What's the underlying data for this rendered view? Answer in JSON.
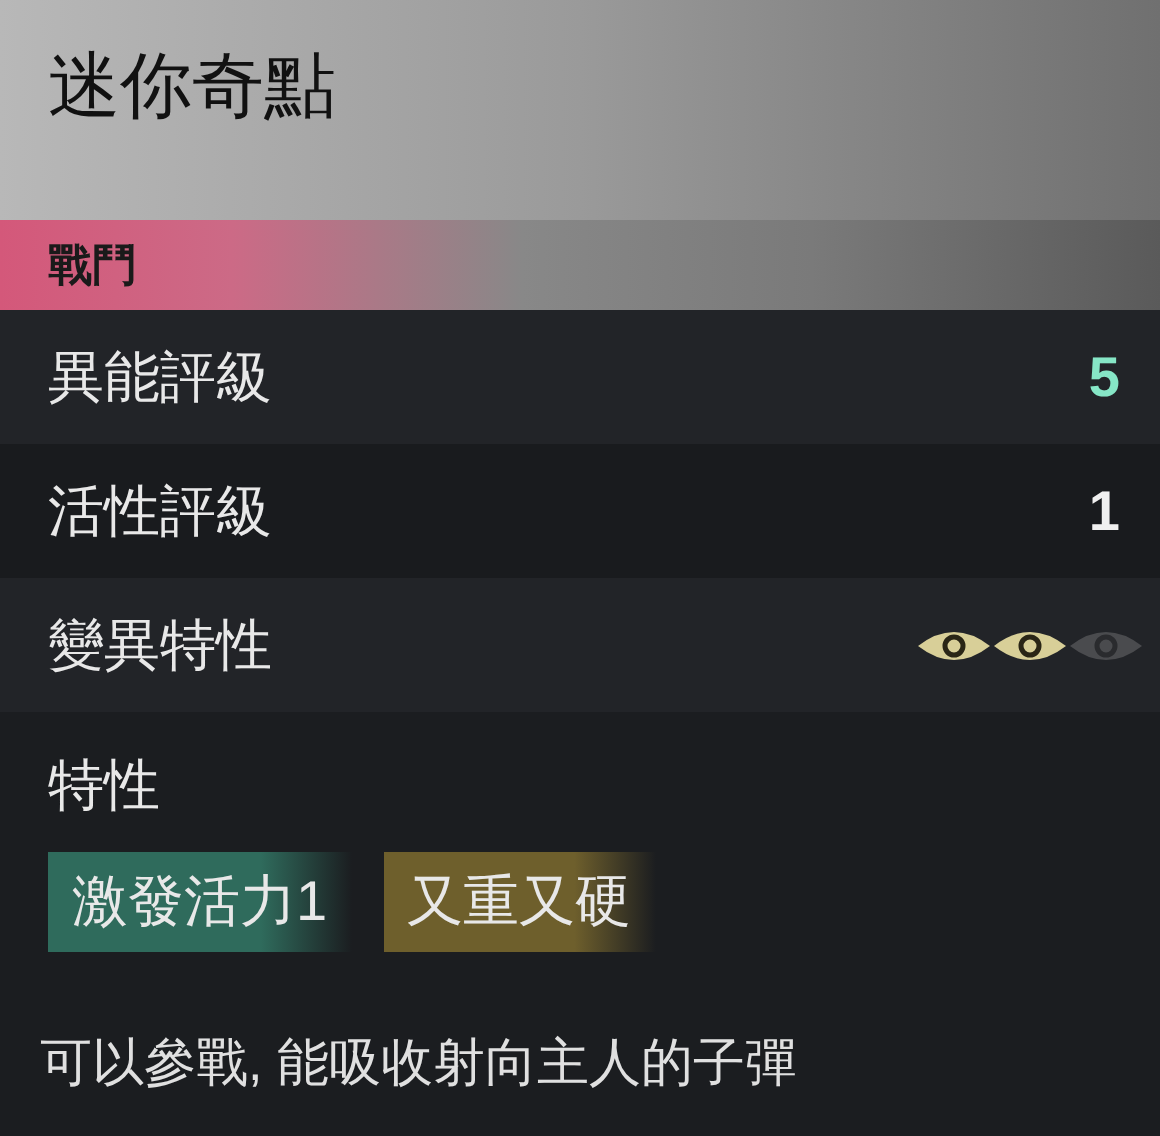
{
  "title": "迷你奇點",
  "section": "戰鬥",
  "rows": [
    {
      "kind": "value",
      "label": "異能評級",
      "value": "5",
      "highlighted": true
    },
    {
      "kind": "value",
      "label": "活性評級",
      "value": "1",
      "highlighted": false
    },
    {
      "kind": "eyes",
      "label": "變異特性",
      "eyes": [
        {
          "on": true
        },
        {
          "on": true
        },
        {
          "on": false
        }
      ]
    }
  ],
  "traits": {
    "label": "特性",
    "tags": [
      {
        "text": "激發活力1",
        "color": "#2f6b5c"
      },
      {
        "text": "又重又硬",
        "color": "#6e5f2c"
      }
    ]
  },
  "description": "可以參戰, 能吸收射向主人的子彈"
}
